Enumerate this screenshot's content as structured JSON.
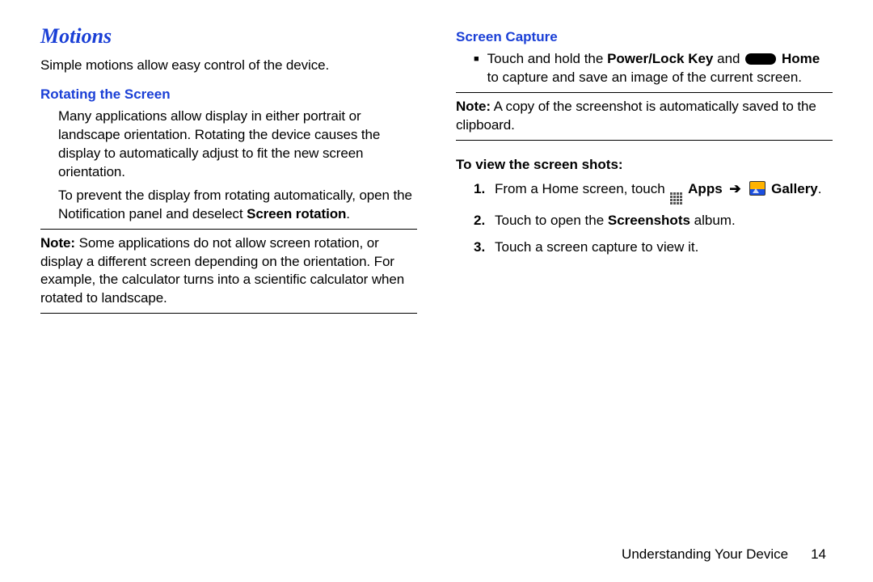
{
  "left": {
    "title": "Motions",
    "intro": "Simple motions allow easy control of the device.",
    "section1_heading": "Rotating the Screen",
    "section1_p1": "Many applications allow display in either portrait or landscape orientation. Rotating the device causes the display to automatically adjust to fit the new screen orientation.",
    "section1_p2_a": "To prevent the display from rotating automatically, open the Notification panel and deselect ",
    "section1_p2_b": "Screen rotation",
    "section1_p2_c": ".",
    "note_label": "Note:",
    "note_text": " Some applications do not allow screen rotation, or display a different screen depending on the orientation. For example, the calculator turns into a scientific calculator when rotated to landscape."
  },
  "right": {
    "section_heading": "Screen Capture",
    "bullet_a": "Touch and hold the ",
    "bullet_b": "Power/Lock Key",
    "bullet_c": " and ",
    "bullet_d": "Home",
    "bullet_e": " to capture and save an image of the current screen.",
    "note_label": "Note:",
    "note_text": " A copy of the screenshot is automatically saved to the clipboard.",
    "subhead": "To view the screen shots:",
    "step1_a": "From a Home screen, touch ",
    "step1_apps": "Apps",
    "step1_arrow": "➔",
    "step1_gallery": "Gallery",
    "step1_end": ".",
    "step2_a": "Touch to open the ",
    "step2_b": "Screenshots",
    "step2_c": " album.",
    "step3": "Touch a screen capture to view it."
  },
  "footer": {
    "chapter": "Understanding Your Device",
    "page": "14"
  }
}
